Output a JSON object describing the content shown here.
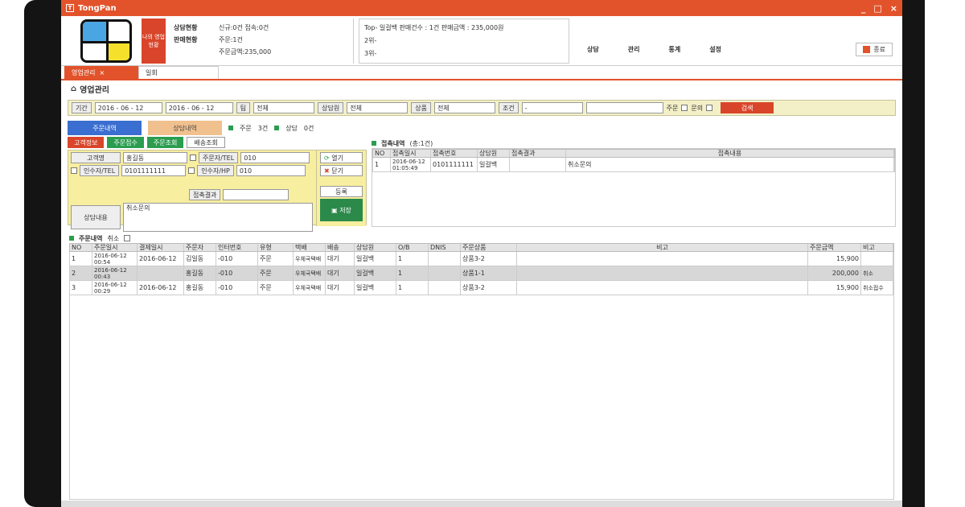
{
  "window": {
    "title": "TongPan",
    "min": "_",
    "max": "□",
    "close": "×"
  },
  "header": {
    "badge_text": "나의 영업 현황",
    "stats": [
      {
        "label": "상담현황",
        "value": "신규:0건  접속:0건"
      },
      {
        "label": "판매현황",
        "value": "주문:1건"
      },
      {
        "label": "",
        "value": "주문금액:235,000"
      }
    ],
    "top3": [
      "Top- 일걸백  판매건수 : 1건   판매금액 : 235,000원",
      "2위-",
      "3위-"
    ],
    "menu": [
      "상담",
      "관리",
      "통계",
      "설정"
    ],
    "close_label": "종료"
  },
  "tabs": [
    {
      "label": "영업관리",
      "close": "×"
    },
    {
      "label": "일회"
    }
  ],
  "section_title": "영업관리",
  "filter": {
    "period_label": "기간",
    "date_from": "2016 - 06 - 12",
    "date_to": "2016 - 06 - 12",
    "team_label": "팀",
    "team_value": "전체",
    "counselor_label": "상담원",
    "counselor_value": "전체",
    "product_label": "상품",
    "product_value": "전체",
    "condition_label": "조건",
    "condition_value": "-",
    "order_label": "주문",
    "inquiry_label": "문의",
    "search_label": "검색"
  },
  "subtabs": {
    "order_tab": "주문내역",
    "consult_tab": "상담내역",
    "order_count_label": "주문",
    "order_count": "3건",
    "consult_count_label": "상담",
    "consult_count": "0건"
  },
  "left_buttons": [
    "고객정보",
    "주문접수",
    "주문조회",
    "배송조회"
  ],
  "form": {
    "customer_label": "고객명",
    "customer_value": "홍길동",
    "orderer_label": "주문자/TEL",
    "orderer_value": "010",
    "phone_label": "인수자/TEL",
    "phone_value": "0101111111",
    "receiver_label": "인수자/HP",
    "receiver_value": "010",
    "result_label": "접촉결과",
    "memo_label": "상담내용",
    "memo_value": "취소문의",
    "side_open": "열기",
    "side_close": "닫기",
    "side_register": "등록",
    "side_save": "저장"
  },
  "contact": {
    "title": "접촉내역",
    "count": "(총:1건)",
    "headers": [
      "NO",
      "접촉일시",
      "접촉번호",
      "상담원",
      "접촉결과",
      "접촉내용"
    ],
    "rows": [
      [
        "1",
        "2016-06-12 01:05:49",
        "0101111111",
        "일걸백",
        "",
        "취소문의"
      ]
    ]
  },
  "orders": {
    "title": "주문내역",
    "cancel_label": "취소",
    "headers": [
      "NO",
      "주문일시",
      "결제일시",
      "주문자",
      "인터번호",
      "유형",
      "택배",
      "배송",
      "상담원",
      "O/B",
      "DNIS",
      "주문상품",
      "비고",
      "주문금액",
      "비고"
    ],
    "rows": [
      [
        "1",
        "2016-06-12 00:54",
        "2016-06-12",
        "김일동",
        "-010",
        "주문",
        "우체국택배",
        "대기",
        "일걸백",
        "1",
        "",
        "상품3-2",
        "",
        "15,900",
        ""
      ],
      [
        "2",
        "2016-06-12 00:43",
        "",
        "홍길동",
        "-010",
        "주문",
        "우체국택배",
        "대기",
        "일걸백",
        "1",
        "",
        "상품1-1",
        "",
        "200,000",
        "취소"
      ],
      [
        "3",
        "2016-06-12 00:29",
        "2016-06-12",
        "홍길동",
        "-010",
        "주문",
        "우체국택배",
        "대기",
        "일걸백",
        "1",
        "",
        "상품3-2",
        "",
        "15,900",
        "취소접수"
      ]
    ]
  }
}
